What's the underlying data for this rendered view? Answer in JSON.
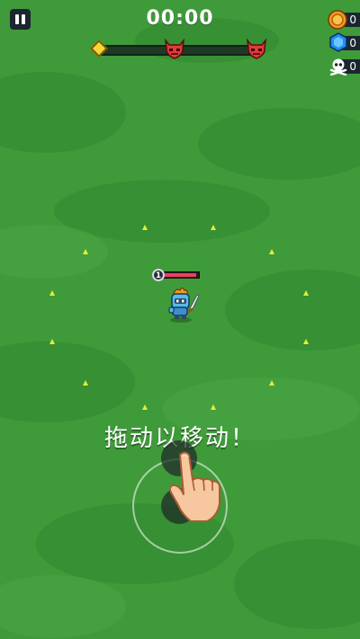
{
  "hud": {
    "timer": "00:00",
    "level_progress": 0.0,
    "counters": [
      {
        "icon": "gold-coin-icon",
        "value": "0"
      },
      {
        "icon": "blue-gem-icon",
        "value": "0"
      },
      {
        "icon": "skull-crossbones-icon",
        "value": "0"
      }
    ]
  },
  "player": {
    "level": "1",
    "health": 0.95
  },
  "tutorial": {
    "hint": "拖动以移动！"
  },
  "colors": {
    "grass": "#3f9a3a",
    "grass_dark": "#368e32",
    "hud_panel": "#1c2630",
    "health": "#e8425a",
    "xp_marker": "#e8ec35",
    "progress_marker": "#f6d536"
  }
}
